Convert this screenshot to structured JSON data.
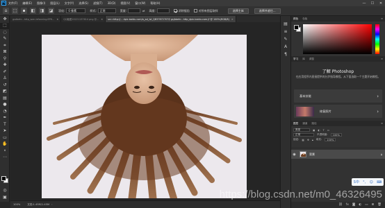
{
  "app": {
    "logo": "Ps"
  },
  "menubar": {
    "items": [
      "文件(F)",
      "编辑(E)",
      "图像(I)",
      "图层(L)",
      "文字(Y)",
      "选择(S)",
      "滤镜(T)",
      "3D(D)",
      "视图(V)",
      "窗口(W)",
      "帮助(H)"
    ],
    "min": "—",
    "max": "☐",
    "close": "✕"
  },
  "options": {
    "feather_label": "羽化:",
    "feather_value": "0 像素",
    "style_label": "样式:",
    "style_value": "正常",
    "width_label": "宽度:",
    "height_label": "高度:",
    "antialias_label": "消除锯齿",
    "antialias_checked": true,
    "sample_all_label": "对所有图层取样",
    "sample_all_checked": false,
    "select_subject": "选择主体",
    "select_mask": "选择并遮住..."
  },
  "tabs": [
    {
      "label": "gsdbehr...http_wen.lefanning.8PH...",
      "active": false
    },
    {
      "label": "QQ截图20221137614 png @...",
      "active": false
    },
    {
      "label": "src=http://... dpic.baidu.com/a_ad_ist_QB37872707f/ gsjbbehr...http_dpic.baidu.com.jf  @ 100%(RGB/8)",
      "active": true
    }
  ],
  "status": {
    "zoom": "100%",
    "docinfo": "文档:1.45M/1.45M"
  },
  "panels": {
    "color_tabs": [
      "颜色",
      "色板"
    ],
    "learn_tabs": [
      "学习",
      "库",
      "调整"
    ],
    "learn_title": "了解 Photoshop",
    "learn_subtitle": "在应用程序内直接提供的分步指导教程。从下面选取一个主题开始教程。",
    "cards": [
      {
        "label": "基本技能"
      },
      {
        "label": "修复照片"
      }
    ],
    "layers_tabs": [
      "图层",
      "通道",
      "路径"
    ],
    "filter_label": "类型",
    "blend_mode": "正常",
    "opacity_label": "不透明度:",
    "opacity_value": "100%",
    "lock_label": "锁定:",
    "fill_label": "填充:",
    "fill_value": "100%",
    "layer_name": "背景"
  },
  "ime": {
    "label": "S中"
  },
  "watermark": "https://blog.csdn.net/m0_46326495",
  "colors": {
    "accent": "#31a8ff",
    "bg": "#262626",
    "panel": "#323232"
  }
}
